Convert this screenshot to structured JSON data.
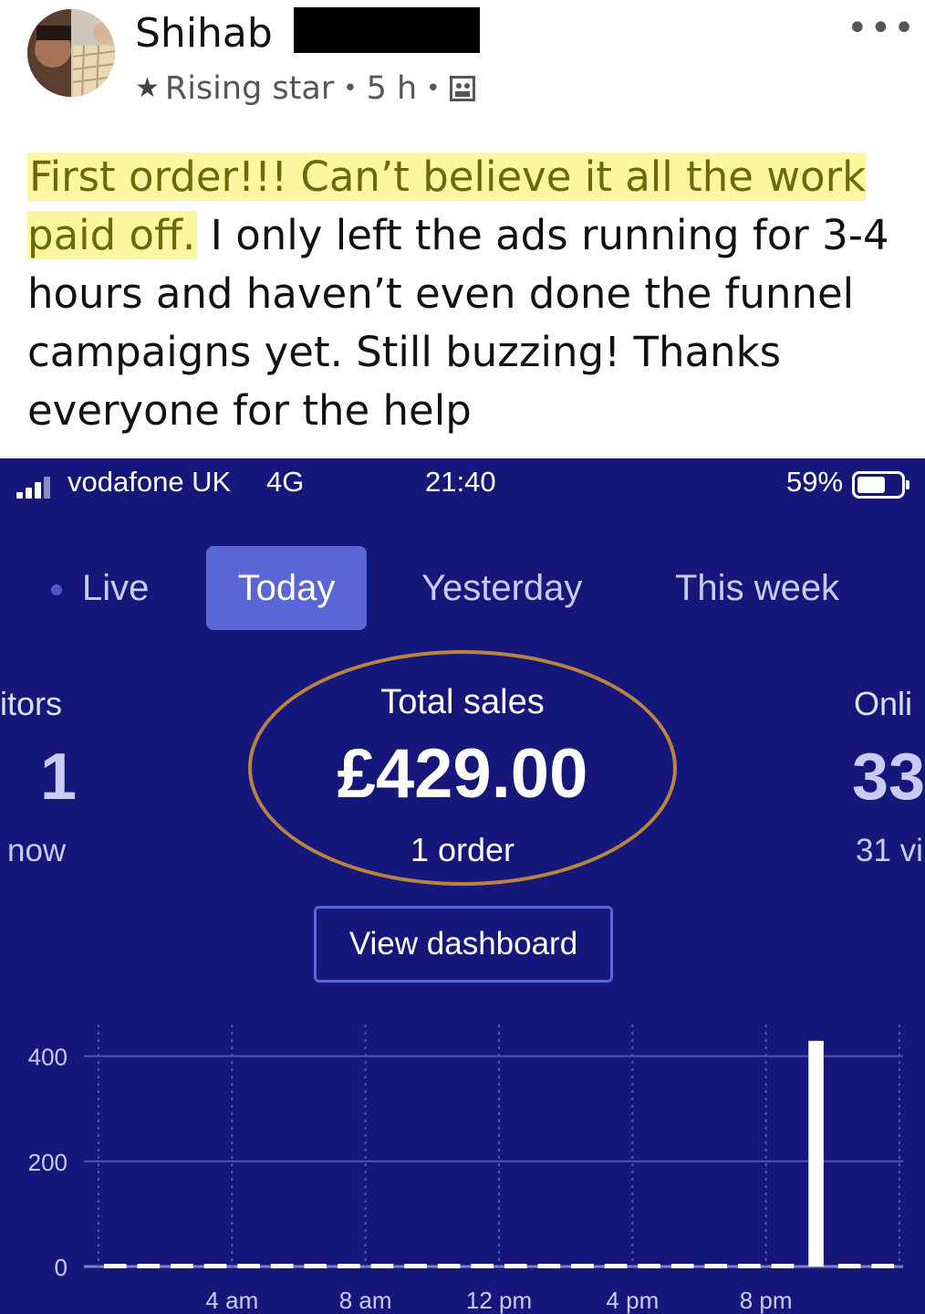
{
  "post": {
    "author": "Shihab",
    "badge": "Rising star",
    "time": "5 h",
    "separator": "•",
    "more_icon": "•••",
    "highlighted_text": "First order!!! Can’t believe it all the work paid off.",
    "body_text": " I only left the ads running for 3-4 hours and haven’t even done the funnel campaigns yet. Still buzzing! Thanks everyone for the help"
  },
  "status_bar": {
    "carrier": "vodafone UK",
    "network": "4G",
    "time": "21:40",
    "battery": "59%"
  },
  "tabs": {
    "live": "Live",
    "today": "Today",
    "yesterday": "Yesterday",
    "this_week": "This week"
  },
  "stats": {
    "visitors_label": "itors",
    "visitors_value": "1",
    "visitors_sub": "now",
    "total_sales_label": "Total sales",
    "total_sales_value": "£429.00",
    "orders": "1 order",
    "online_label": "Onli",
    "online_value": "33",
    "online_sub": "31 vi"
  },
  "dashboard_button": "View dashboard",
  "colors": {
    "screen_bg": "#15187a",
    "active_tab": "#5b66d6",
    "highlight": "#fbf7a1",
    "circle": "#b8843f"
  },
  "chart_data": {
    "type": "bar",
    "y_ticks": [
      "400",
      "200",
      "0"
    ],
    "x_tick_labels": [
      "4 am",
      "8 am",
      "12 pm",
      "4 pm",
      "8 pm"
    ],
    "ylim": [
      0,
      460
    ],
    "grid": true,
    "values": [
      0,
      0,
      0,
      0,
      0,
      0,
      0,
      0,
      0,
      0,
      0,
      0,
      0,
      0,
      0,
      0,
      0,
      0,
      0,
      0,
      0,
      429,
      0,
      0
    ]
  }
}
